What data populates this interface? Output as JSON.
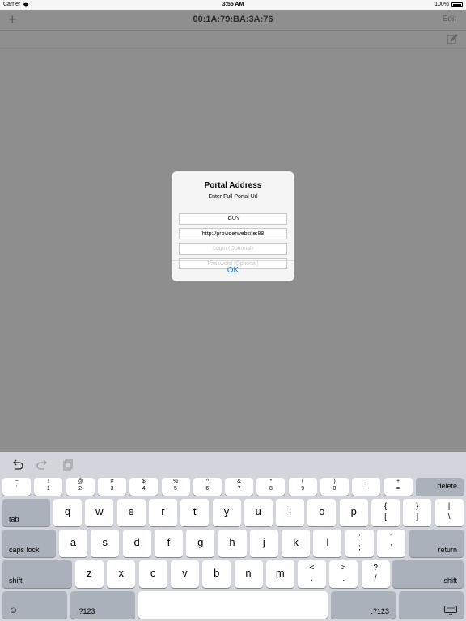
{
  "status": {
    "carrier": "Carrier",
    "time": "3:55 AM",
    "battery": "100%"
  },
  "navbar": {
    "title": "00:1A:79:BA:3A:76",
    "edit_label": "Edit"
  },
  "alert": {
    "title": "Portal Address",
    "message": "Enter Full Portal Url",
    "fields": [
      {
        "value": "IGUY",
        "placeholder": ""
      },
      {
        "value": "http://providerwebsite:88",
        "placeholder": ""
      },
      {
        "value": "",
        "placeholder": "Login (Optional)"
      },
      {
        "value": "",
        "placeholder": "Password (Optional)"
      }
    ],
    "ok_label": "OK"
  },
  "keyboard": {
    "row1": [
      {
        "top": "~",
        "bot": "`"
      },
      {
        "top": "!",
        "bot": "1"
      },
      {
        "top": "@",
        "bot": "2"
      },
      {
        "top": "#",
        "bot": "3"
      },
      {
        "top": "$",
        "bot": "4"
      },
      {
        "top": "%",
        "bot": "5"
      },
      {
        "top": "^",
        "bot": "6"
      },
      {
        "top": "&",
        "bot": "7"
      },
      {
        "top": "*",
        "bot": "8"
      },
      {
        "top": "(",
        "bot": "9"
      },
      {
        "top": ")",
        "bot": "0"
      },
      {
        "top": "_",
        "bot": "-"
      },
      {
        "top": "+",
        "bot": "="
      }
    ],
    "delete_label": "delete",
    "tab_label": "tab",
    "row2": [
      "q",
      "w",
      "e",
      "r",
      "t",
      "y",
      "u",
      "i",
      "o",
      "p"
    ],
    "row2_symbols": [
      {
        "top": "{",
        "bot": "["
      },
      {
        "top": "}",
        "bot": "]"
      },
      {
        "top": "|",
        "bot": "\\"
      }
    ],
    "caps_label": "caps lock",
    "row3": [
      "a",
      "s",
      "d",
      "f",
      "g",
      "h",
      "j",
      "k",
      "l"
    ],
    "row3_symbols": [
      {
        "top": ":",
        "bot": ";"
      },
      {
        "top": "”",
        "bot": "’"
      }
    ],
    "return_label": "return",
    "shift_label": "shift",
    "row4": [
      "z",
      "x",
      "c",
      "v",
      "b",
      "n",
      "m"
    ],
    "row4_symbols": [
      {
        "top": "<",
        "bot": ","
      },
      {
        "top": ">",
        "bot": "."
      },
      {
        "top": "?",
        "bot": "/"
      }
    ],
    "numbers_label": ".?123",
    "emoji_glyph": "☺"
  }
}
